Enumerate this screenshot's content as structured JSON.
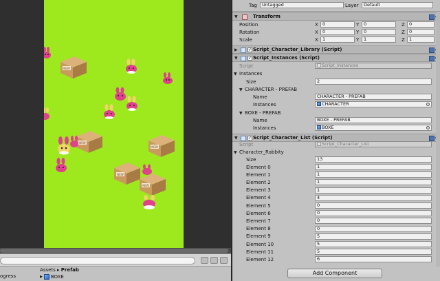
{
  "top": {
    "tag_label": "Tag",
    "tag_value": "Untagged",
    "layer_label": "Layer",
    "layer_value": "Default"
  },
  "transform": {
    "title": "Transform",
    "rows": [
      {
        "label": "Position",
        "x": "0",
        "y": "0",
        "z": "0"
      },
      {
        "label": "Rotation",
        "x": "0",
        "y": "0",
        "z": "0"
      },
      {
        "label": "Scale",
        "x": "1",
        "y": "1",
        "z": "1"
      }
    ],
    "axes": {
      "x": "X",
      "y": "Y",
      "z": "Z"
    }
  },
  "comp_library": {
    "title": "Script_Character_Library (Script)",
    "checked": "✓"
  },
  "comp_instances": {
    "title": "Script_Instances (Script)",
    "checked": "✓",
    "script_label": "Script",
    "script_value": "Script_Instances",
    "instances_label": "Instances",
    "size_label": "Size",
    "size_value": "2",
    "groups": [
      {
        "header": "CHARACTER - PREFAB",
        "name_label": "Name",
        "name_value": "CHARACTER - PREFAB",
        "inst_label": "Instances",
        "inst_value": "CHARACTER"
      },
      {
        "header": "BOXE - PREFAB",
        "name_label": "Name",
        "name_value": "BOXE - PREFAB",
        "inst_label": "Instances",
        "inst_value": "BOXE"
      }
    ]
  },
  "comp_list": {
    "title": "Script_Character_List (Script)",
    "checked": "✓",
    "script_label": "Script",
    "script_value": "Script_Character_List",
    "array_label": "Character_Rabbity",
    "size_label": "Size",
    "size_value": "13",
    "elements": [
      {
        "label": "Element 0",
        "value": "1"
      },
      {
        "label": "Element 1",
        "value": "1"
      },
      {
        "label": "Element 2",
        "value": "1"
      },
      {
        "label": "Element 3",
        "value": "1"
      },
      {
        "label": "Element 4",
        "value": "4"
      },
      {
        "label": "Element 5",
        "value": "0"
      },
      {
        "label": "Element 6",
        "value": "0"
      },
      {
        "label": "Element 7",
        "value": "0"
      },
      {
        "label": "Element 8",
        "value": "0"
      },
      {
        "label": "Element 9",
        "value": "5"
      },
      {
        "label": "Element 10",
        "value": "5"
      },
      {
        "label": "Element 11",
        "value": "5"
      },
      {
        "label": "Element 12",
        "value": "6"
      }
    ]
  },
  "add_component_label": "Add Component",
  "project": {
    "progress_label": "ogress",
    "breadcrumb_root": "Assets",
    "breadcrumb_sep": "▸",
    "breadcrumb_current": "Prefab",
    "asset_name": "BOXE",
    "box_label": "NEW"
  },
  "icons": {
    "fold_open": "▼",
    "fold_closed": "▶",
    "gear": "⚙"
  },
  "colors": {
    "game_bg": "#9ee81e",
    "box": "#c99a5e",
    "bunny": "#e0408c"
  }
}
